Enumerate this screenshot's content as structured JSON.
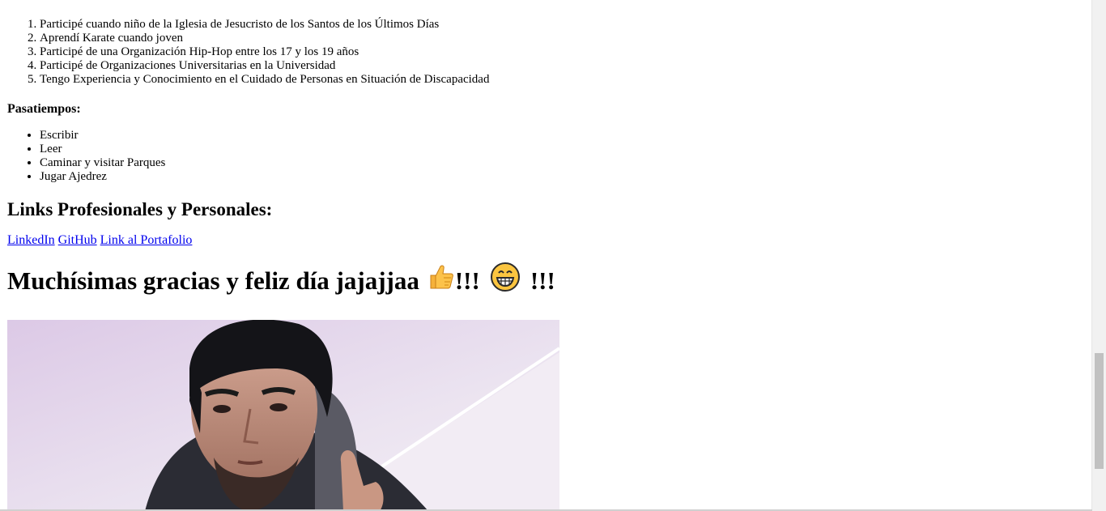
{
  "experience": [
    "Participé cuando niño de la Iglesia de Jesucristo de los Santos de los Últimos Días",
    "Aprendí Karate cuando joven",
    "Participé de una Organización Hip-Hop entre los 17 y los 19 años",
    "Participé de Organizaciones Universitarias en la Universidad",
    "Tengo Experiencia y Conocimiento en el Cuidado de Personas en Situación de Discapacidad"
  ],
  "hobbies": {
    "title": "Pasatiempos:",
    "items": [
      "Escribir",
      "Leer",
      "Caminar y visitar Parques",
      "Jugar Ajedrez"
    ]
  },
  "links": {
    "title": "Links Profesionales y Personales:",
    "items": [
      {
        "label": "LinkedIn"
      },
      {
        "label": "GitHub"
      },
      {
        "label": "Link al Portafolio"
      }
    ]
  },
  "thanks": {
    "text": "Muchísimas gracias y feliz día jajajjaa",
    "after_thumb": "!!!",
    "after_grin": "!!!"
  },
  "icons": {
    "thumb": "thumbs-up-icon",
    "grin": "grinning-face-icon"
  },
  "colors": {
    "link": "#0000ee",
    "scroll_track": "#f1f1f1",
    "scroll_thumb": "#c1c1c1"
  }
}
